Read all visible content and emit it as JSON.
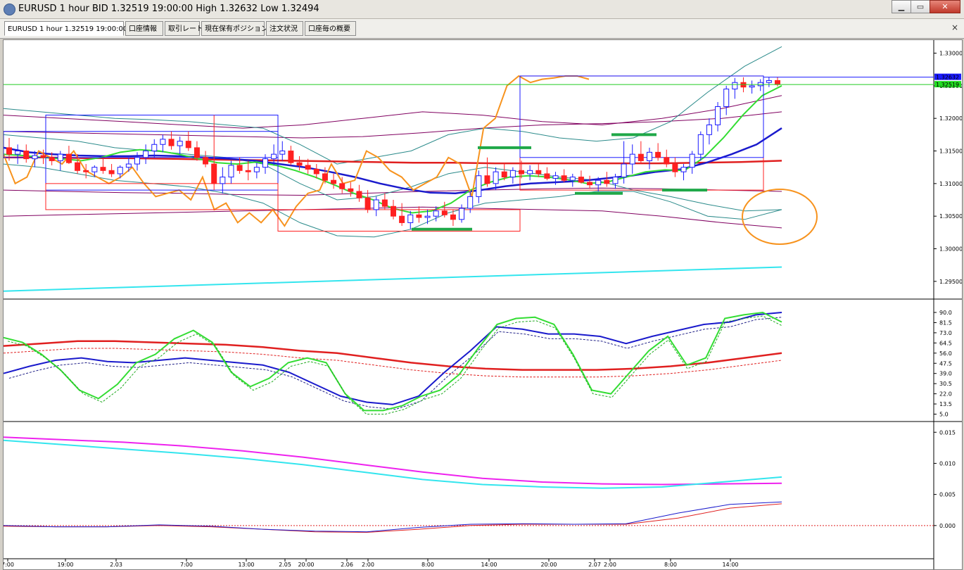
{
  "window": {
    "title": "EURUSD 1 hour BID 1.32519 19:00:00 High 1.32632 Low 1.32494",
    "buttons": {
      "minimize": "▁",
      "restore": "▭",
      "close": "✕"
    }
  },
  "tabs": [
    {
      "label": "EURUSD 1 hour 1.32519 19:00:00",
      "active": true
    },
    {
      "label": "口座情報",
      "active": false
    },
    {
      "label": "取引レート",
      "active": false
    },
    {
      "label": "現在保有ポジション",
      "active": false
    },
    {
      "label": "注文状況",
      "active": false
    },
    {
      "label": "口座毎の概要",
      "active": false
    }
  ],
  "tab_close": "×",
  "colors": {
    "bullish": "#1a1aff",
    "bearish": "#ff2020",
    "orange": "#f7931e",
    "green_ma": "#33dd33",
    "blue_ma": "#1a1acc",
    "red_ma": "#e02020",
    "purple": "#800060",
    "teal": "#2a8a8a",
    "cyan": "#33e5ee",
    "magenta": "#ee22ee",
    "marker_green": "#1fa848",
    "bid_line": "#22cc22"
  },
  "chart_data": [
    {
      "type": "candlestick",
      "symbol": "EURUSD",
      "timeframe": "1 hour",
      "ylim": [
        1.2925,
        1.332
      ],
      "y_ticks": [
        "1.33000",
        "1.32500",
        "1.32000",
        "1.31500",
        "1.31000",
        "1.30500",
        "1.30000",
        "1.29500"
      ],
      "price_labels": [
        "1.32632",
        "1.32519"
      ],
      "x_ticks": [
        "7:00",
        "19:00",
        "2.03",
        "7:00",
        "13:00",
        "2.05",
        "20:00",
        "2.06",
        "2:00",
        "8:00",
        "14:00",
        "20:00",
        "2.07",
        "2:00",
        "8:00",
        "14:00"
      ],
      "bid_price": 1.32519,
      "high_price": 1.32632,
      "candles_ohlc": [
        [
          1.3155,
          1.317,
          1.3135,
          1.3145
        ],
        [
          1.3145,
          1.316,
          1.313,
          1.315
        ],
        [
          1.315,
          1.316,
          1.3132,
          1.3138
        ],
        [
          1.3138,
          1.315,
          1.3125,
          1.3143
        ],
        [
          1.3143,
          1.3152,
          1.313,
          1.314
        ],
        [
          1.314,
          1.3148,
          1.3128,
          1.3135
        ],
        [
          1.3135,
          1.315,
          1.312,
          1.3145
        ],
        [
          1.3145,
          1.3158,
          1.313,
          1.3132
        ],
        [
          1.3132,
          1.3145,
          1.3115,
          1.312
        ],
        [
          1.312,
          1.313,
          1.3108,
          1.3118
        ],
        [
          1.3118,
          1.3128,
          1.311,
          1.3125
        ],
        [
          1.3125,
          1.3138,
          1.3115,
          1.312
        ],
        [
          1.312,
          1.313,
          1.311,
          1.3115
        ],
        [
          1.3115,
          1.3128,
          1.3108,
          1.3125
        ],
        [
          1.3125,
          1.314,
          1.3118,
          1.313
        ],
        [
          1.313,
          1.3148,
          1.312,
          1.314
        ],
        [
          1.314,
          1.316,
          1.313,
          1.315
        ],
        [
          1.315,
          1.3168,
          1.314,
          1.316
        ],
        [
          1.316,
          1.3175,
          1.3148,
          1.3168
        ],
        [
          1.3168,
          1.318,
          1.3152,
          1.3158
        ],
        [
          1.3158,
          1.3172,
          1.3145,
          1.3165
        ],
        [
          1.3165,
          1.318,
          1.315,
          1.3155
        ],
        [
          1.3155,
          1.3165,
          1.3135,
          1.314
        ],
        [
          1.314,
          1.315,
          1.3125,
          1.313
        ],
        [
          1.313,
          1.3205,
          1.309,
          1.31
        ],
        [
          1.31,
          1.3125,
          1.3085,
          1.311
        ],
        [
          1.311,
          1.3135,
          1.31,
          1.3128
        ],
        [
          1.3128,
          1.314,
          1.3115,
          1.312
        ],
        [
          1.312,
          1.3135,
          1.3105,
          1.3118
        ],
        [
          1.3118,
          1.3132,
          1.3108,
          1.3125
        ],
        [
          1.3125,
          1.3145,
          1.3115,
          1.3138
        ],
        [
          1.3138,
          1.316,
          1.3128,
          1.3145
        ],
        [
          1.3145,
          1.3165,
          1.3135,
          1.315
        ],
        [
          1.315,
          1.3158,
          1.3128,
          1.3132
        ],
        [
          1.3132,
          1.3142,
          1.312,
          1.3128
        ],
        [
          1.3128,
          1.3138,
          1.3115,
          1.3122
        ],
        [
          1.3122,
          1.313,
          1.3108,
          1.3115
        ],
        [
          1.3115,
          1.3125,
          1.31,
          1.3105
        ],
        [
          1.3105,
          1.3115,
          1.3092,
          1.31
        ],
        [
          1.31,
          1.311,
          1.3085,
          1.3092
        ],
        [
          1.3092,
          1.3102,
          1.308,
          1.3088
        ],
        [
          1.3088,
          1.3098,
          1.3072,
          1.3078
        ],
        [
          1.3078,
          1.309,
          1.3055,
          1.306
        ],
        [
          1.306,
          1.308,
          1.305,
          1.3075
        ],
        [
          1.3075,
          1.3085,
          1.306,
          1.3065
        ],
        [
          1.3065,
          1.3075,
          1.3045,
          1.305
        ],
        [
          1.305,
          1.307,
          1.3035,
          1.304
        ],
        [
          1.304,
          1.3058,
          1.303,
          1.3052
        ],
        [
          1.3052,
          1.3065,
          1.304,
          1.3048
        ],
        [
          1.3048,
          1.306,
          1.3038,
          1.305
        ],
        [
          1.305,
          1.3065,
          1.3042,
          1.3058
        ],
        [
          1.3058,
          1.3072,
          1.3048,
          1.3052
        ],
        [
          1.3052,
          1.306,
          1.3035,
          1.3045
        ],
        [
          1.3045,
          1.3068,
          1.304,
          1.3062
        ],
        [
          1.3062,
          1.3088,
          1.3055,
          1.308
        ],
        [
          1.308,
          1.312,
          1.307,
          1.3112
        ],
        [
          1.3112,
          1.314,
          1.3095,
          1.31
        ],
        [
          1.31,
          1.3125,
          1.309,
          1.3118
        ],
        [
          1.3118,
          1.3132,
          1.3105,
          1.311
        ],
        [
          1.311,
          1.3125,
          1.31,
          1.312
        ],
        [
          1.312,
          1.3135,
          1.3108,
          1.3115
        ],
        [
          1.3115,
          1.3128,
          1.3105,
          1.312
        ],
        [
          1.312,
          1.313,
          1.311,
          1.3115
        ],
        [
          1.3115,
          1.3125,
          1.3105,
          1.3108
        ],
        [
          1.3108,
          1.3118,
          1.3098,
          1.3112
        ],
        [
          1.3112,
          1.3122,
          1.3102,
          1.3105
        ],
        [
          1.3105,
          1.3115,
          1.3095,
          1.311
        ],
        [
          1.311,
          1.312,
          1.31,
          1.3102
        ],
        [
          1.3102,
          1.3112,
          1.3092,
          1.3098
        ],
        [
          1.3098,
          1.311,
          1.3088,
          1.3105
        ],
        [
          1.3105,
          1.3118,
          1.3095,
          1.31
        ],
        [
          1.31,
          1.3115,
          1.3092,
          1.311
        ],
        [
          1.311,
          1.3165,
          1.31,
          1.313
        ],
        [
          1.313,
          1.316,
          1.3115,
          1.3145
        ],
        [
          1.3145,
          1.3165,
          1.313,
          1.3135
        ],
        [
          1.3135,
          1.3155,
          1.3122,
          1.3148
        ],
        [
          1.3148,
          1.3162,
          1.3135,
          1.314
        ],
        [
          1.314,
          1.3152,
          1.3125,
          1.313
        ],
        [
          1.313,
          1.314,
          1.311,
          1.3118
        ],
        [
          1.3118,
          1.313,
          1.3105,
          1.3125
        ],
        [
          1.3125,
          1.315,
          1.3115,
          1.3145
        ],
        [
          1.3145,
          1.318,
          1.3135,
          1.3175
        ],
        [
          1.3175,
          1.32,
          1.316,
          1.319
        ],
        [
          1.319,
          1.3225,
          1.318,
          1.3218
        ],
        [
          1.3218,
          1.325,
          1.3205,
          1.3245
        ],
        [
          1.3245,
          1.3262,
          1.323,
          1.3255
        ],
        [
          1.3255,
          1.3263,
          1.324,
          1.3248
        ],
        [
          1.3248,
          1.3258,
          1.3238,
          1.325
        ],
        [
          1.325,
          1.326,
          1.3242,
          1.3255
        ],
        [
          1.3255,
          1.3263,
          1.3248,
          1.3258
        ],
        [
          1.3258,
          1.3263,
          1.3249,
          1.32519
        ]
      ],
      "overlays": {
        "orange_line": [
          1.3145,
          1.31,
          1.311,
          1.315,
          1.314,
          1.313,
          1.315,
          1.312,
          1.311,
          1.31,
          1.311,
          1.3125,
          1.31,
          1.308,
          1.3085,
          1.309,
          1.3075,
          1.311,
          1.306,
          1.307,
          1.304,
          1.3055,
          1.304,
          1.306,
          1.3035,
          1.3065,
          1.3085,
          1.309,
          1.313,
          1.31,
          1.3105,
          1.315,
          1.314,
          1.312,
          1.311,
          1.309,
          1.31,
          1.311,
          1.314,
          1.313,
          1.308,
          1.3185,
          1.32,
          1.325,
          1.3265,
          1.3255,
          1.326,
          1.3262,
          1.3265,
          1.3265,
          1.326
        ],
        "green_ma": [
          1.3145,
          1.3143,
          1.314,
          1.3138,
          1.3135,
          1.314,
          1.3148,
          1.3152,
          1.315,
          1.3145,
          1.3138,
          1.3132,
          1.313,
          1.3133,
          1.3128,
          1.312,
          1.311,
          1.3098,
          1.3085,
          1.3075,
          1.3062,
          1.3055,
          1.3058,
          1.307,
          1.309,
          1.3102,
          1.311,
          1.3112,
          1.311,
          1.3106,
          1.31,
          1.3102,
          1.311,
          1.3118,
          1.3121,
          1.312,
          1.314,
          1.317,
          1.3205,
          1.3235,
          1.325
        ],
        "blue_ma": [
          1.3155,
          1.3148,
          1.3145,
          1.3143,
          1.3142,
          1.3142,
          1.3143,
          1.3142,
          1.314,
          1.3138,
          1.3135,
          1.313,
          1.3125,
          1.3118,
          1.311,
          1.31,
          1.3092,
          1.3086,
          1.3085,
          1.309,
          1.3096,
          1.31,
          1.3102,
          1.3104,
          1.3108,
          1.3112,
          1.3118,
          1.3122,
          1.3132,
          1.3145,
          1.316,
          1.3185
        ],
        "red_ma": [
          1.314,
          1.314,
          1.3139,
          1.3139,
          1.3138,
          1.3137,
          1.3136,
          1.3135,
          1.3134,
          1.3133,
          1.3132,
          1.3132,
          1.3131,
          1.3131,
          1.3131,
          1.3131,
          1.3131,
          1.3132,
          1.3133,
          1.3135
        ],
        "cyan_ma": [
          1.2935,
          1.2972
        ],
        "purple_lines": [
          [
            1.3205,
            1.32,
            1.3195,
            1.319,
            1.3185,
            1.319,
            1.32,
            1.321,
            1.3205,
            1.3195,
            1.319,
            1.32,
            1.3215,
            1.3235
          ],
          [
            1.309,
            1.3088,
            1.3086,
            1.3085,
            1.3083,
            1.3082,
            1.3085,
            1.3088,
            1.309,
            1.3092,
            1.3093,
            1.3092,
            1.309,
            1.3088
          ],
          [
            1.305,
            1.3052,
            1.3054,
            1.3056,
            1.3058,
            1.306,
            1.3062,
            1.3064,
            1.3062,
            1.306,
            1.3058,
            1.305,
            1.304,
            1.3032
          ],
          [
            1.318,
            1.3178,
            1.3176,
            1.3174,
            1.3172,
            1.317,
            1.3172,
            1.3178,
            1.3185,
            1.319,
            1.3192,
            1.3195,
            1.32,
            1.321
          ]
        ],
        "teal_bands": [
          [
            1.3215,
            1.321,
            1.3205,
            1.32,
            1.3198,
            1.3195,
            1.319,
            1.3185,
            1.316,
            1.313,
            1.314,
            1.315,
            1.3175,
            1.3185,
            1.318,
            1.317,
            1.3165,
            1.317,
            1.3195,
            1.324,
            1.328,
            1.331
          ],
          [
            1.3175,
            1.317,
            1.3165,
            1.3155,
            1.315,
            1.3145,
            1.314,
            1.313,
            1.31,
            1.3075,
            1.308,
            1.3095,
            1.3115,
            1.3125,
            1.3118,
            1.311,
            1.3105,
            1.309,
            1.308,
            1.3068,
            1.3058,
            1.306
          ],
          [
            1.313,
            1.3125,
            1.3115,
            1.3105,
            1.31,
            1.3095,
            1.3085,
            1.307,
            1.304,
            1.302,
            1.3018,
            1.303,
            1.3055,
            1.307,
            1.3075,
            1.308,
            1.3088,
            1.3088,
            1.3072,
            1.305,
            1.3045,
            1.306
          ]
        ]
      }
    },
    {
      "type": "line",
      "name": "stochastic",
      "ylim": [
        0,
        100
      ],
      "y_ticks": [
        "90.0",
        "81.5",
        "73.0",
        "64.5",
        "56.0",
        "47.5",
        "39.0",
        "30.5",
        "22.0",
        "13.5",
        "5.0"
      ],
      "series": [
        {
          "color": "#33dd33",
          "values": [
            69,
            65,
            55,
            42,
            25,
            18,
            30,
            48,
            55,
            68,
            75,
            65,
            40,
            28,
            35,
            48,
            52,
            48,
            22,
            8,
            8,
            12,
            20,
            25,
            38,
            60,
            80,
            85,
            86,
            80,
            55,
            25,
            22,
            40,
            58,
            70,
            46,
            52,
            85,
            88,
            90,
            82
          ]
        },
        {
          "color": "#1a1acc",
          "values": [
            39,
            45,
            50,
            52,
            49,
            48,
            50,
            52,
            50,
            48,
            46,
            40,
            30,
            20,
            15,
            13,
            20,
            40,
            58,
            78,
            76,
            72,
            72,
            70,
            64,
            70,
            75,
            80,
            82,
            88,
            90
          ]
        },
        {
          "color": "#e02020",
          "values": [
            62,
            64,
            66,
            66,
            65,
            64,
            63,
            61,
            58,
            56,
            52,
            48,
            45,
            43,
            42,
            42,
            42,
            43,
            45,
            48,
            52,
            56
          ]
        }
      ]
    },
    {
      "type": "line",
      "name": "macd",
      "ylim": [
        -0.005,
        0.0165
      ],
      "y_ticks": [
        "0.015",
        "0.010",
        "0.005",
        "0.000"
      ],
      "series": [
        {
          "color": "#ee22ee",
          "values": [
            0.0142,
            0.0138,
            0.0134,
            0.0128,
            0.012,
            0.011,
            0.0098,
            0.0086,
            0.0076,
            0.007,
            0.0067,
            0.0066,
            0.0067,
            0.0068
          ]
        },
        {
          "color": "#33e5ee",
          "values": [
            0.0137,
            0.013,
            0.0123,
            0.0116,
            0.0108,
            0.0098,
            0.0086,
            0.0074,
            0.0066,
            0.0062,
            0.006,
            0.0062,
            0.007,
            0.0078
          ]
        },
        {
          "color": "#1a1acc",
          "values": [
            0.0,
            -0.0002,
            -0.0002,
            0.0001,
            -0.0001,
            -0.0006,
            -0.0009,
            -0.001,
            -0.0003,
            0.0002,
            0.0003,
            0.0002,
            0.0003,
            0.002,
            0.0034,
            0.0038
          ]
        },
        {
          "color": "#e02020",
          "values": [
            -0.0001,
            -0.0002,
            -0.0002,
            0.0,
            -0.0002,
            -0.0006,
            -0.001,
            -0.0011,
            -0.0006,
            0.0,
            0.0002,
            0.0002,
            0.0002,
            0.0012,
            0.0028,
            0.0035
          ]
        }
      ]
    }
  ]
}
